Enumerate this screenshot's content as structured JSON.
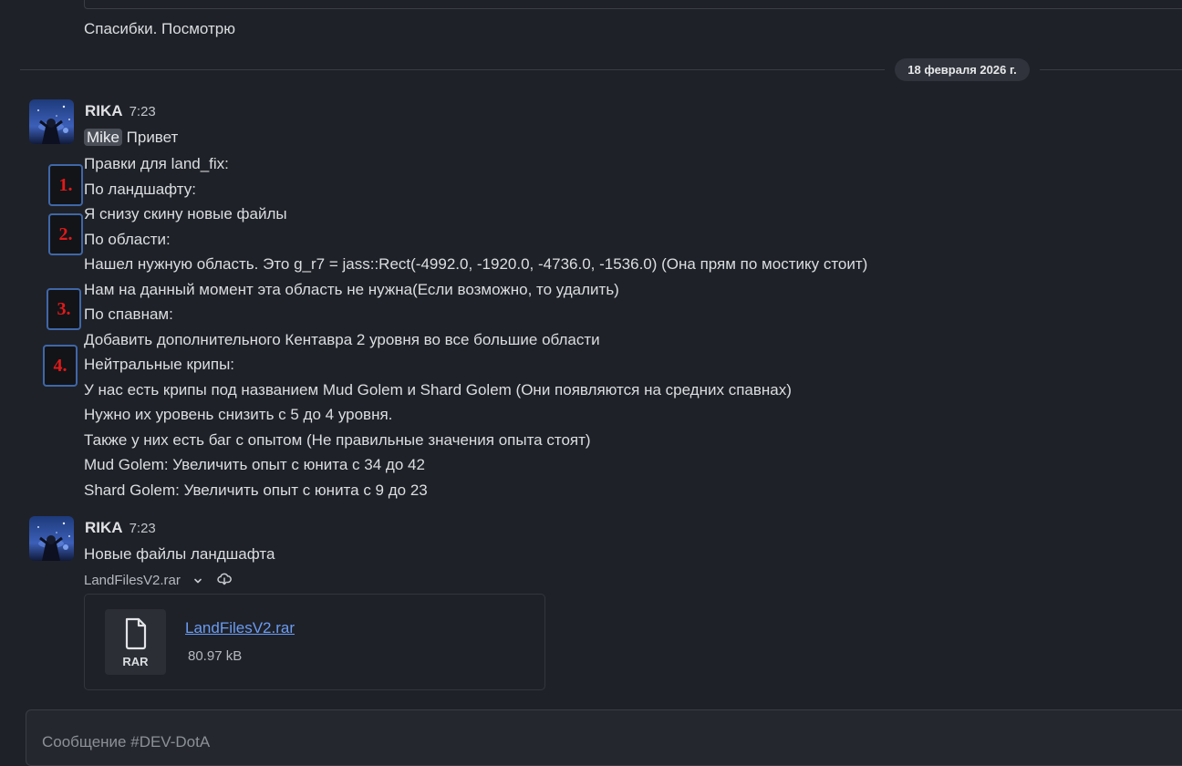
{
  "previous_message": {
    "text": "Спасибки. Посмотрю"
  },
  "date_divider": {
    "label": "18 февраля 2026 г."
  },
  "messages": [
    {
      "author": "RIKA",
      "time": "7:23",
      "mention": "Mike",
      "greeting": "Привет",
      "lines": [
        "Правки для land_fix:",
        "По ландшафту:",
        "Я снизу скину новые файлы",
        "По области:",
        "Нашел нужную область. Это g_r7 = jass::Rect(-4992.0, -1920.0, -4736.0, -1536.0) (Она прям по мостику стоит)",
        "Нам на данный момент эта область не нужна(Если возможно, то удалить)",
        "По спавнам:",
        "Добавить дополнительного Кентавра 2 уровня во все большие области",
        "Нейтральные крипы:",
        "У нас есть крипы под названием Mud Golem и Shard Golem (Они появляются на средних спавнах)",
        "Нужно их уровень снизить с 5 до 4 уровня.",
        "Также у них есть баг с опытом (Не правильные значения опыта стоят)",
        "Mud Golem: Увеличить опыт с юнита с 34 до 42",
        "Shard Golem: Увеличить опыт с юнита с 9 до 23"
      ]
    },
    {
      "author": "RIKA",
      "time": "7:23",
      "text": "Новые файлы ландшафта"
    }
  ],
  "annotations": [
    "1.",
    "2.",
    "3.",
    "4."
  ],
  "attachment": {
    "filename_header": "LandFilesV2.rar",
    "link": "LandFilesV2.rar",
    "size": "80.97 kB",
    "type_label": "RAR",
    "icons": [
      "chevron-down-icon",
      "download-icon",
      "file-icon"
    ]
  },
  "composer": {
    "placeholder": "Сообщение #DEV-DotA"
  },
  "colors": {
    "background": "#1f2128",
    "link": "#6a9cf2",
    "annotation_border": "#3f67a8",
    "annotation_text": "#e01a1a",
    "mention_bg": "#4b4f58"
  }
}
